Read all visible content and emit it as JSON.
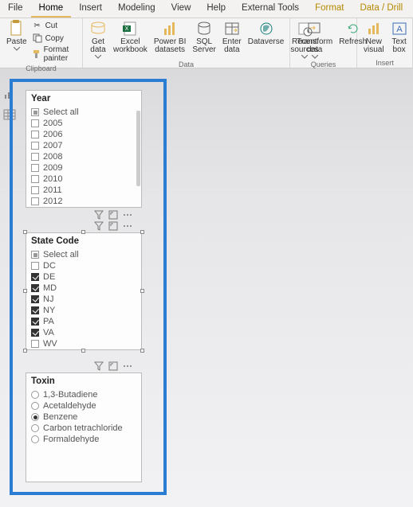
{
  "tabs": {
    "file": "File",
    "home": "Home",
    "insert": "Insert",
    "modeling": "Modeling",
    "view": "View",
    "help": "Help",
    "ext": "External Tools",
    "format": "Format",
    "data_drill": "Data / Drill"
  },
  "ribbon": {
    "clipboard": {
      "paste": "Paste",
      "cut": "Cut",
      "copy": "Copy",
      "format_painter": "Format painter",
      "label": "Clipboard"
    },
    "data": {
      "get": "Get\ndata",
      "excel": "Excel\nworkbook",
      "pbi": "Power BI\ndatasets",
      "sql": "SQL\nServer",
      "enter": "Enter\ndata",
      "dataverse": "Dataverse",
      "recent": "Recent\nsources",
      "label": "Data"
    },
    "queries": {
      "transform": "Transform\ndata",
      "refresh": "Refresh",
      "label": "Queries"
    },
    "insert": {
      "new_visual": "New\nvisual",
      "text_box": "Text\nbox",
      "label": "Insert"
    }
  },
  "slicers": {
    "year": {
      "title": "Year",
      "items": [
        {
          "label": "Select all",
          "state": "tri"
        },
        {
          "label": "2005",
          "state": "off"
        },
        {
          "label": "2006",
          "state": "off"
        },
        {
          "label": "2007",
          "state": "off"
        },
        {
          "label": "2008",
          "state": "off"
        },
        {
          "label": "2009",
          "state": "off"
        },
        {
          "label": "2010",
          "state": "off"
        },
        {
          "label": "2011",
          "state": "off"
        },
        {
          "label": "2012",
          "state": "off"
        }
      ]
    },
    "state": {
      "title": "State Code",
      "items": [
        {
          "label": "Select all",
          "state": "tri"
        },
        {
          "label": "DC",
          "state": "off"
        },
        {
          "label": "DE",
          "state": "on"
        },
        {
          "label": "MD",
          "state": "on"
        },
        {
          "label": "NJ",
          "state": "on"
        },
        {
          "label": "NY",
          "state": "on"
        },
        {
          "label": "PA",
          "state": "on"
        },
        {
          "label": "VA",
          "state": "on"
        },
        {
          "label": "WV",
          "state": "off"
        }
      ]
    },
    "toxin": {
      "title": "Toxin",
      "items": [
        {
          "label": "1,3-Butadiene",
          "sel": false
        },
        {
          "label": "Acetaldehyde",
          "sel": false
        },
        {
          "label": "Benzene",
          "sel": true
        },
        {
          "label": "Carbon tetrachloride",
          "sel": false
        },
        {
          "label": "Formaldehyde",
          "sel": false
        }
      ]
    }
  }
}
